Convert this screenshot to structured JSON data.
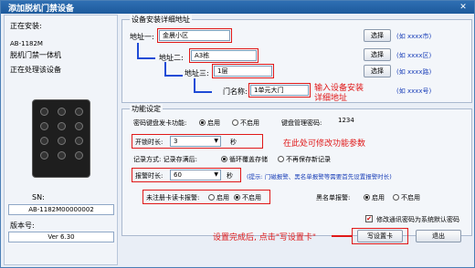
{
  "window": {
    "title": "添加脱机门禁设备"
  },
  "left": {
    "install_label": "正在安装:",
    "model": "AB-1182M",
    "model_desc": "脱机门禁一体机",
    "processing": "正在处理该设备",
    "sn_label": "SN:",
    "sn_value": "AB-1182M00000002",
    "version_label": "版本号:",
    "version_value": "Ver 6.30"
  },
  "address": {
    "group_label": "设备安装详细地址",
    "addr1_label": "地址一:",
    "addr1_value": "金晨小区",
    "addr2_label": "地址二:",
    "addr2_value": "A3栋",
    "addr3_label": "地址三:",
    "addr3_value": "1层",
    "door_label": "门名称:",
    "door_value": "1单元大门",
    "choose": "选择",
    "hint1": "(如 xxxx市)",
    "hint2": "(如 xxxx区)",
    "hint3": "(如 xxxx路)",
    "hint4": "(如 xxxx号)",
    "annotation": "输入设备安装详细地址"
  },
  "function": {
    "group_label": "功能设定",
    "pwd_kb_label": "密码键盘发卡功能:",
    "enable": "启用",
    "disable": "不启用",
    "kb_mgmt_pwd_label": "键盘管理密码:",
    "kb_mgmt_pwd_value": "1234",
    "open_time_label": "开锁时长:",
    "open_time_value": "3",
    "seconds": "秒",
    "record_label": "记录方式: 记录存满后:",
    "record_cycle": "循环覆盖存储",
    "record_stop": "不再保存新记录",
    "alarm_time_label": "报警时长:",
    "alarm_time_value": "60",
    "note": "(提示: 门磁报警、黑名单报警等需要首先设置报警时长)",
    "unreg_alarm_label": "未注册卡读卡报警:",
    "blacklist_alarm_label": "黑名单报警:",
    "annotation": "在此处可修改功能参数",
    "modify_pwd_label": "修改通讯密码为系统默认密码"
  },
  "footer": {
    "instruction": "设置完成后, 点击\"写设置卡\"",
    "write_button": "写设置卡",
    "exit_button": "退出"
  },
  "colors": {
    "annotation_red": "#e01818",
    "hint_blue": "#1a3fb8",
    "title_blue": "#1d5a9c"
  }
}
